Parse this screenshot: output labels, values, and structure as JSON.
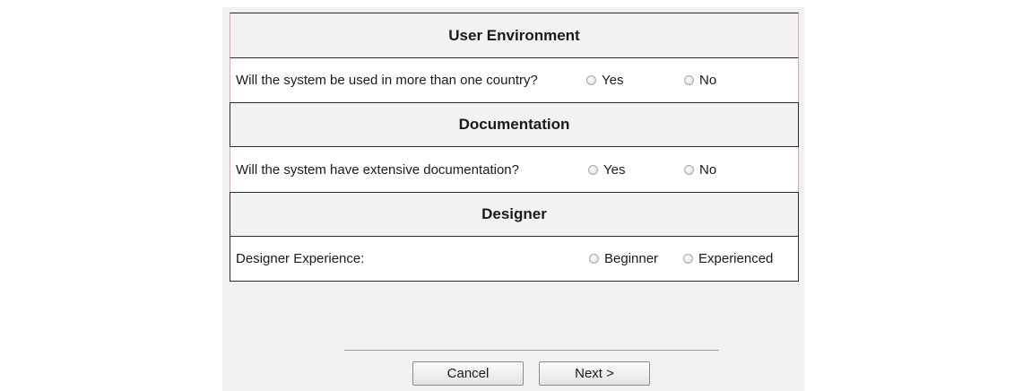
{
  "sections": [
    {
      "title": "User Environment",
      "question": "Will the system be used in more than one country?",
      "options": [
        "Yes",
        "No"
      ]
    },
    {
      "title": "Documentation",
      "question": "Will the system have extensive documentation?",
      "options": [
        "Yes",
        "No"
      ]
    },
    {
      "title": "Designer",
      "question": "Designer Experience:",
      "options": [
        "Beginner",
        "Experienced"
      ]
    }
  ],
  "buttons": {
    "cancel": "Cancel",
    "next": "Next >"
  }
}
